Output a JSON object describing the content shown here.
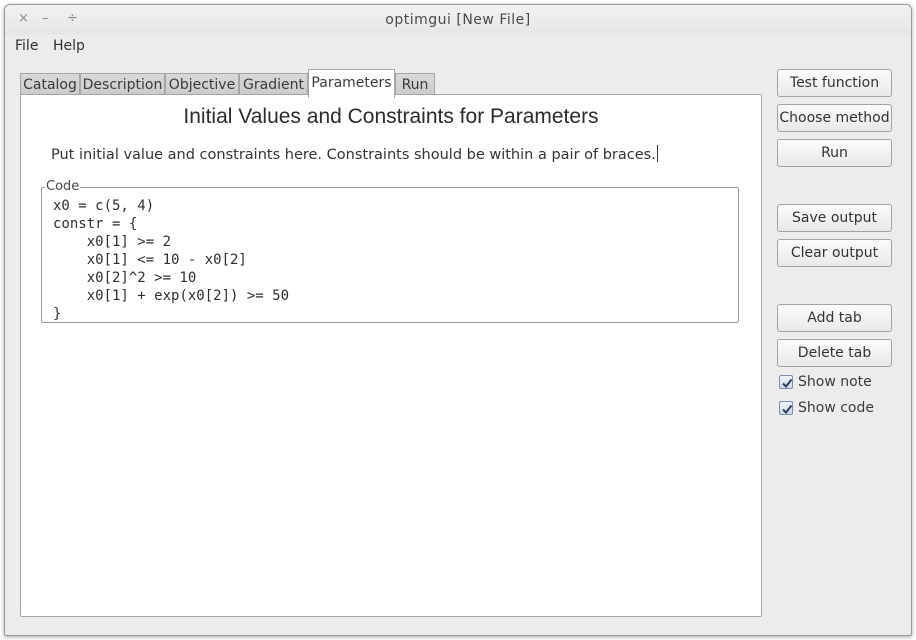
{
  "window": {
    "title": "optimgui [New File]",
    "controls": {
      "close": "×",
      "minimize": "–",
      "maximize": "÷"
    }
  },
  "menu": [
    {
      "label": "File"
    },
    {
      "label": "Help"
    }
  ],
  "tabs": [
    {
      "label": "Catalog"
    },
    {
      "label": "Description"
    },
    {
      "label": "Objective"
    },
    {
      "label": "Gradient"
    },
    {
      "label": "Parameters"
    },
    {
      "label": "Run"
    }
  ],
  "active_tab": "Parameters",
  "panel": {
    "title": "Initial Values and Constraints for Parameters",
    "note": "Put initial value and constraints here. Constraints should be within a pair of braces.",
    "code_legend": "Code",
    "code": "x0 = c(5, 4)\nconstr = {\n    x0[1] >= 2\n    x0[1] <= 10 - x0[2]\n    x0[2]^2 >= 10\n    x0[1] + exp(x0[2]) >= 50\n}"
  },
  "sidebar": {
    "test_function": "Test function",
    "choose_method": "Choose method",
    "run": "Run",
    "save_output": "Save output",
    "clear_output": "Clear output",
    "add_tab": "Add tab",
    "delete_tab": "Delete tab",
    "show_note": {
      "label": "Show note",
      "checked": true
    },
    "show_code": {
      "label": "Show code",
      "checked": true
    }
  }
}
